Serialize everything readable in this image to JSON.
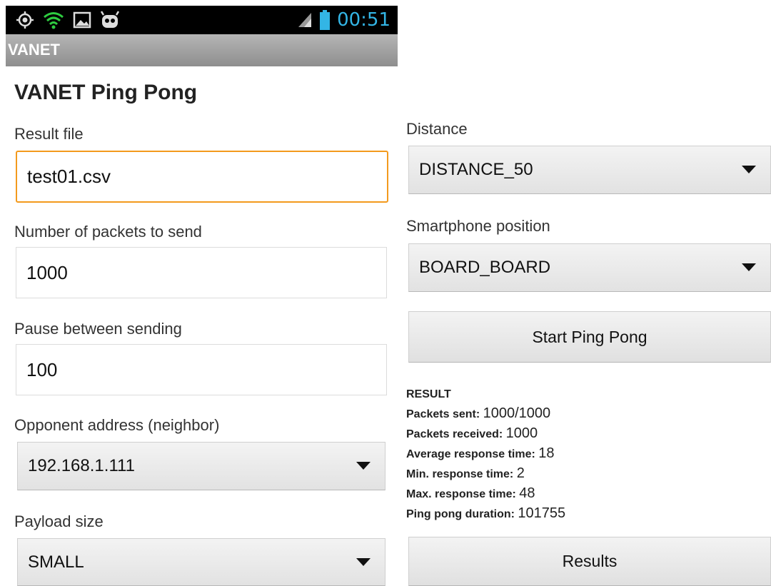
{
  "statusbar": {
    "time": "00:51"
  },
  "app_title": "VANET",
  "page_title": "VANET Ping Pong",
  "result_file": {
    "label": "Result file",
    "value": "test01.csv"
  },
  "packets": {
    "label": "Number of packets to send",
    "value": "1000"
  },
  "pause": {
    "label": "Pause between sending",
    "value": "100"
  },
  "opponent": {
    "label": "Opponent address (neighbor)",
    "value": "192.168.1.111"
  },
  "payload": {
    "label": "Payload size",
    "value": "SMALL"
  },
  "distance": {
    "label": "Distance",
    "value": "DISTANCE_50"
  },
  "position": {
    "label": "Smartphone position",
    "value": "BOARD_BOARD"
  },
  "start_button": "Start Ping Pong",
  "results_button": "Results",
  "result": {
    "header": "RESULT",
    "rows": [
      {
        "label": "Packets sent: ",
        "value": "1000/1000"
      },
      {
        "label": "Packets received: ",
        "value": "1000"
      },
      {
        "label": "Average response time: ",
        "value": "18"
      },
      {
        "label": "Min. response time: ",
        "value": "2"
      },
      {
        "label": "Max. response time: ",
        "value": "48"
      },
      {
        "label": "Ping pong duration: ",
        "value": "101755"
      }
    ]
  }
}
